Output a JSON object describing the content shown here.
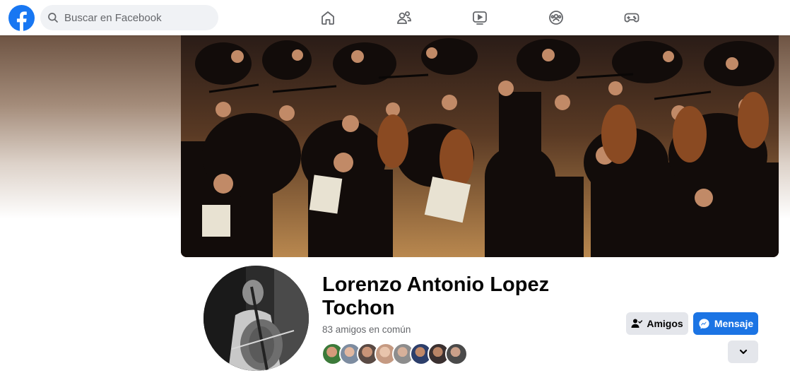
{
  "search": {
    "placeholder": "Buscar en Facebook"
  },
  "nav": [
    "home-icon",
    "friends-icon",
    "watch-icon",
    "groups-icon",
    "gaming-icon"
  ],
  "profile": {
    "name": "Lorenzo Antonio Lopez Tochon",
    "mutual_friends": "83 amigos en común",
    "mutual_friend_avatars": 8
  },
  "actions": {
    "friends_label": "Amigos",
    "message_label": "Mensaje",
    "more_icon": "chevron-down-icon"
  },
  "colors": {
    "brand": "#1877f2",
    "button_primary": "#1b74e4",
    "button_secondary": "#e4e6eb",
    "secondary_text": "#65676b"
  }
}
